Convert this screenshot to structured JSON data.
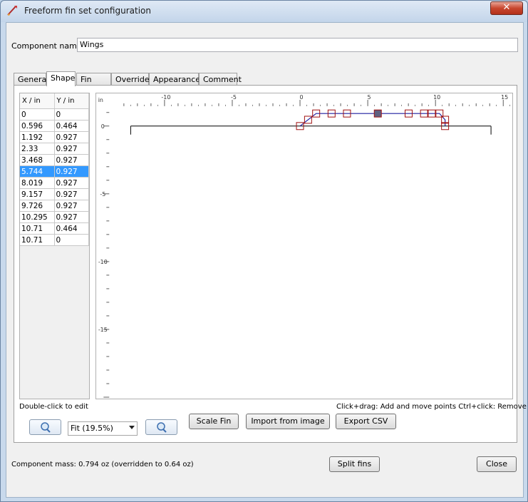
{
  "window": {
    "title": "Freeform fin set configuration",
    "close_glyph": "✕"
  },
  "component": {
    "name_label": "Component name:",
    "name_value": "Wings"
  },
  "tabs": [
    {
      "label": "General"
    },
    {
      "label": "Shape",
      "active": true
    },
    {
      "label": "Fin tabs"
    },
    {
      "label": "Override"
    },
    {
      "label": "Appearance"
    },
    {
      "label": "Comment"
    }
  ],
  "points_table": {
    "headers": [
      "X / in",
      "Y / in"
    ],
    "rows": [
      [
        "0",
        "0"
      ],
      [
        "0.596",
        "0.464"
      ],
      [
        "1.192",
        "0.927"
      ],
      [
        "2.33",
        "0.927"
      ],
      [
        "3.468",
        "0.927"
      ],
      [
        "5.744",
        "0.927"
      ],
      [
        "8.019",
        "0.927"
      ],
      [
        "9.157",
        "0.927"
      ],
      [
        "9.726",
        "0.927"
      ],
      [
        "10.295",
        "0.927"
      ],
      [
        "10.71",
        "0.464"
      ],
      [
        "10.71",
        "0"
      ]
    ],
    "selected_row": 5
  },
  "plot": {
    "unit_label": "in",
    "x_ticks": [
      "-10",
      "-5",
      "0",
      "5",
      "10",
      "15"
    ],
    "y_ticks": [
      "0",
      "-5",
      "-10",
      "-15"
    ],
    "fin_points": [
      [
        0,
        0
      ],
      [
        0.596,
        0.464
      ],
      [
        1.192,
        0.927
      ],
      [
        2.33,
        0.927
      ],
      [
        3.468,
        0.927
      ],
      [
        5.744,
        0.927
      ],
      [
        8.019,
        0.927
      ],
      [
        9.157,
        0.927
      ],
      [
        9.726,
        0.927
      ],
      [
        10.295,
        0.927
      ],
      [
        10.71,
        0.464
      ],
      [
        10.71,
        0
      ]
    ],
    "body_tube": {
      "x_start": -12.5,
      "x_end": 14.1
    },
    "colors": {
      "fin": "#1f1fa0",
      "handle": "#a01010",
      "selected_handle": "#606080",
      "body": "#000000"
    }
  },
  "hints": {
    "left": "Double-click to edit",
    "right": "Click+drag: Add and move points   Ctrl+click: Remove point"
  },
  "zoom": {
    "in_icon": "zoom-in-icon",
    "out_icon": "zoom-out-icon",
    "selected": "Fit (19.5%)"
  },
  "buttons": {
    "scale_fin": "Scale Fin",
    "import_image": "Import from image",
    "export_csv": "Export CSV",
    "split_fins": "Split fins",
    "close": "Close"
  },
  "status": {
    "mass": "Component mass: 0.794 oz (overridden to 0.64 oz)"
  }
}
